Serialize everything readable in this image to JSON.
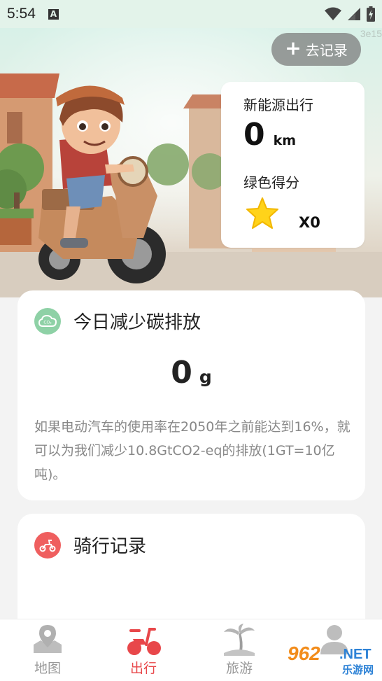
{
  "status_bar": {
    "time": "5:54",
    "notification_letter": "A",
    "icons": [
      "wifi-icon",
      "signal-icon",
      "battery-charging-icon"
    ]
  },
  "hero": {
    "watermark_text": "3e15",
    "record_button": {
      "icon": "plus-icon",
      "label": "去记录"
    },
    "stats": {
      "title": "新能源出行",
      "distance_value": "0",
      "distance_unit": "km",
      "green_title": "绿色得分",
      "star_icon": "star-icon",
      "score": "X0"
    }
  },
  "carbon": {
    "icon": "co2-icon",
    "title": "今日减少碳排放",
    "value": "0",
    "unit": "g",
    "description": "如果电动汽车的使用率在2050年之前能达到16%，就可以为我们减少10.8GtCO2-eq的排放(1GT=10亿吨)。"
  },
  "ride": {
    "icon": "scooter-icon",
    "title": "骑行记录"
  },
  "nav": {
    "items": [
      {
        "label": "地图",
        "icon": "map-pin-icon",
        "active": false
      },
      {
        "label": "出行",
        "icon": "scooter-icon",
        "active": true
      },
      {
        "label": "旅游",
        "icon": "palm-tree-icon",
        "active": false
      },
      {
        "label": "",
        "icon": "user-icon",
        "active": false
      }
    ]
  },
  "watermark": {
    "number": "962",
    "domain": ".NET",
    "site_name": "乐游网"
  },
  "colors": {
    "accent_red": "#e8474a",
    "green_icon": "#8ed1a6",
    "star_yellow": "#ffd31a",
    "hero_mint": "#dff2ea"
  }
}
